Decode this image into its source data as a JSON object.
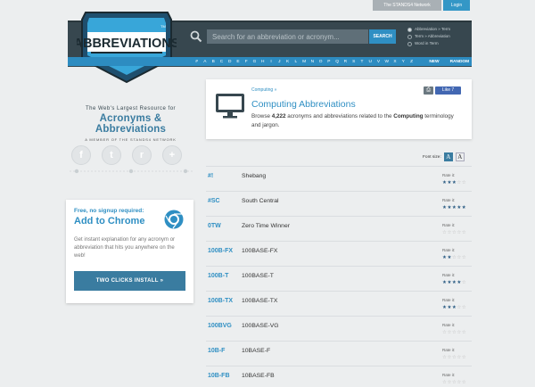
{
  "top": {
    "network_label": "The STANDS4 Network",
    "login_label": "Login"
  },
  "logo": {
    "text": "ABBREVIATIONS",
    "tm": "TM"
  },
  "search": {
    "placeholder": "Search for an abbreviation or acronym...",
    "button_label": "SEARCH"
  },
  "modes": [
    {
      "label": "Abbreviation » Term",
      "selected": true
    },
    {
      "label": "Term » Abbreviation",
      "selected": false
    },
    {
      "label": "Word in Term",
      "selected": false
    }
  ],
  "alphabet": [
    "#",
    "A",
    "B",
    "C",
    "D",
    "E",
    "F",
    "G",
    "H",
    "I",
    "J",
    "K",
    "L",
    "M",
    "N",
    "O",
    "P",
    "Q",
    "R",
    "S",
    "T",
    "U",
    "V",
    "W",
    "X",
    "Y",
    "Z"
  ],
  "nav": {
    "new": "NEW",
    "random": "RANDOM"
  },
  "tagline": {
    "line1": "The Web's Largest Resource for",
    "line2": "Acronyms & Abbreviations",
    "network": "A MEMBER OF THE STANDS4 NETWORK"
  },
  "social": [
    {
      "icon": "facebook-icon",
      "glyph": "f"
    },
    {
      "icon": "twitter-icon",
      "glyph": "t"
    },
    {
      "icon": "reddit-icon",
      "glyph": "r"
    },
    {
      "icon": "plus-icon",
      "glyph": "+"
    }
  ],
  "chrome": {
    "small": "Free, no signup required:",
    "big": "Add to Chrome",
    "description": "Get instant explanation for any acronym or abbreviation that hits you anywhere on the web!",
    "button": "TWO CLICKS INSTALL »"
  },
  "category": {
    "breadcrumb": "Computing »",
    "title": "Computing Abbreviations",
    "desc_pre": "Browse ",
    "count": "4,222",
    "desc_mid": " acronyms and abbreviations related to the ",
    "category_name": "Computing",
    "desc_post": " terminology and jargon.",
    "like_label": "Like 7"
  },
  "font_size": {
    "label": "Font size:",
    "options": [
      "A",
      "A"
    ]
  },
  "rate_label": "Rate it:",
  "colors": {
    "accent": "#2f8fc3",
    "header_bg": "#37474f",
    "nav_bar": "#2d8cc1"
  },
  "entries": [
    {
      "abbr": "#!",
      "term": "Shebang",
      "rating": 3
    },
    {
      "abbr": "#SC",
      "term": "South Central",
      "rating": 5
    },
    {
      "abbr": "0TW",
      "term": "Zero Time Winner",
      "rating": 0
    },
    {
      "abbr": "100B-FX",
      "term": "100BASE-FX",
      "rating": 2
    },
    {
      "abbr": "100B-T",
      "term": "100BASE-T",
      "rating": 4
    },
    {
      "abbr": "100B-TX",
      "term": "100BASE-TX",
      "rating": 3
    },
    {
      "abbr": "100BVG",
      "term": "100BASE-VG",
      "rating": 0
    },
    {
      "abbr": "10B-F",
      "term": "10BASE-F",
      "rating": 0
    },
    {
      "abbr": "10B-FB",
      "term": "10BASE-FB",
      "rating": 0
    }
  ]
}
